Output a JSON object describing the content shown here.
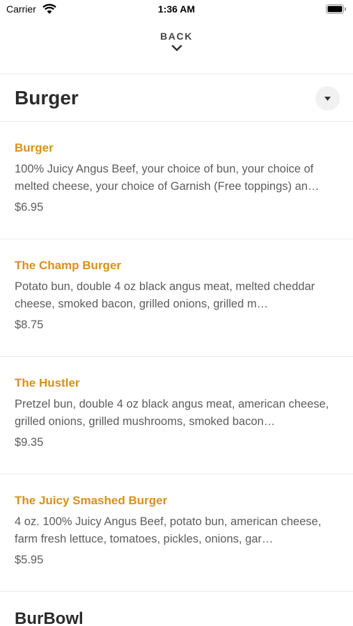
{
  "status_bar": {
    "carrier": "Carrier",
    "time": "1:36 AM"
  },
  "nav": {
    "back_label": "BACK"
  },
  "category": {
    "title": "Burger"
  },
  "items": [
    {
      "name": "Burger",
      "description": "100% Juicy Angus Beef, your choice of bun, your choice of melted cheese, your choice of Garnish (Free toppings) an…",
      "price": "$6.95"
    },
    {
      "name": "The Champ Burger",
      "description": "Potato bun, double 4 oz black angus meat, melted cheddar cheese, smoked bacon, grilled onions, grilled m…",
      "price": "$8.75"
    },
    {
      "name": "The Hustler",
      "description": "Pretzel bun, double 4 oz black angus meat, american cheese, grilled onions, grilled mushrooms, smoked bacon…",
      "price": "$9.35"
    },
    {
      "name": "The Juicy Smashed Burger",
      "description": "4 oz. 100% Juicy Angus Beef, potato bun, american cheese, farm fresh lettuce, tomatoes, pickles, onions, gar…",
      "price": "$5.95"
    }
  ],
  "next_category": {
    "title": "BurBowl"
  },
  "colors": {
    "item_name": "#d8901a",
    "text": "#5c5c5c",
    "heading": "#2b2b2b"
  },
  "icons": {
    "wifi": "wifi-icon",
    "battery": "battery-icon",
    "back": "chevron-down-icon",
    "dropdown": "caret-down-icon"
  }
}
